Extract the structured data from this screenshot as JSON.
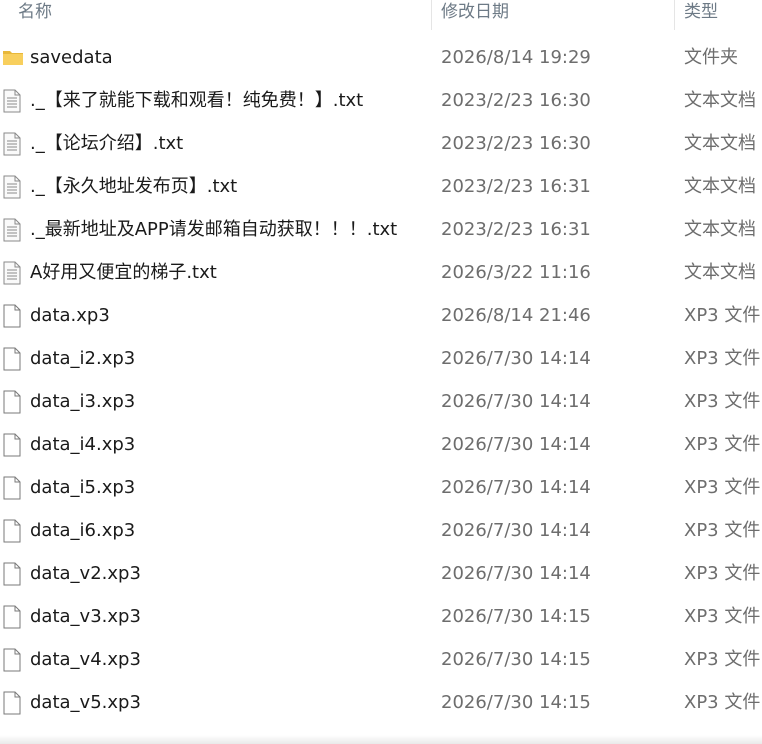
{
  "columns": {
    "name": "名称",
    "date": "修改日期",
    "type": "类型"
  },
  "rows": [
    {
      "name": "savedata",
      "date": "2026/8/14 19:29",
      "type": "文件夹",
      "icon": "folder-icon"
    },
    {
      "name": "._【来了就能下载和观看！纯免费！】.txt",
      "date": "2023/2/23 16:30",
      "type": "文本文档",
      "icon": "text-file-icon"
    },
    {
      "name": "._【论坛介绍】.txt",
      "date": "2023/2/23 16:30",
      "type": "文本文档",
      "icon": "text-file-icon"
    },
    {
      "name": "._【永久地址发布页】.txt",
      "date": "2023/2/23 16:31",
      "type": "文本文档",
      "icon": "text-file-icon"
    },
    {
      "name": "._最新地址及APP请发邮箱自动获取！！！.txt",
      "date": "2023/2/23 16:31",
      "type": "文本文档",
      "icon": "text-file-icon"
    },
    {
      "name": "A好用又便宜的梯子.txt",
      "date": "2026/3/22 11:16",
      "type": "文本文档",
      "icon": "text-file-icon"
    },
    {
      "name": "data.xp3",
      "date": "2026/8/14 21:46",
      "type": "XP3 文件",
      "icon": "blank-file-icon"
    },
    {
      "name": "data_i2.xp3",
      "date": "2026/7/30 14:14",
      "type": "XP3 文件",
      "icon": "blank-file-icon"
    },
    {
      "name": "data_i3.xp3",
      "date": "2026/7/30 14:14",
      "type": "XP3 文件",
      "icon": "blank-file-icon"
    },
    {
      "name": "data_i4.xp3",
      "date": "2026/7/30 14:14",
      "type": "XP3 文件",
      "icon": "blank-file-icon"
    },
    {
      "name": "data_i5.xp3",
      "date": "2026/7/30 14:14",
      "type": "XP3 文件",
      "icon": "blank-file-icon"
    },
    {
      "name": "data_i6.xp3",
      "date": "2026/7/30 14:14",
      "type": "XP3 文件",
      "icon": "blank-file-icon"
    },
    {
      "name": "data_v2.xp3",
      "date": "2026/7/30 14:14",
      "type": "XP3 文件",
      "icon": "blank-file-icon"
    },
    {
      "name": "data_v3.xp3",
      "date": "2026/7/30 14:15",
      "type": "XP3 文件",
      "icon": "blank-file-icon"
    },
    {
      "name": "data_v4.xp3",
      "date": "2026/7/30 14:15",
      "type": "XP3 文件",
      "icon": "blank-file-icon"
    },
    {
      "name": "data_v5.xp3",
      "date": "2026/7/30 14:15",
      "type": "XP3 文件",
      "icon": "blank-file-icon"
    }
  ],
  "colors": {
    "header_text": "#6d7a86",
    "folder": "#f8cf5d",
    "text": "#1a1a1a",
    "muted": "#6d6d6d"
  }
}
